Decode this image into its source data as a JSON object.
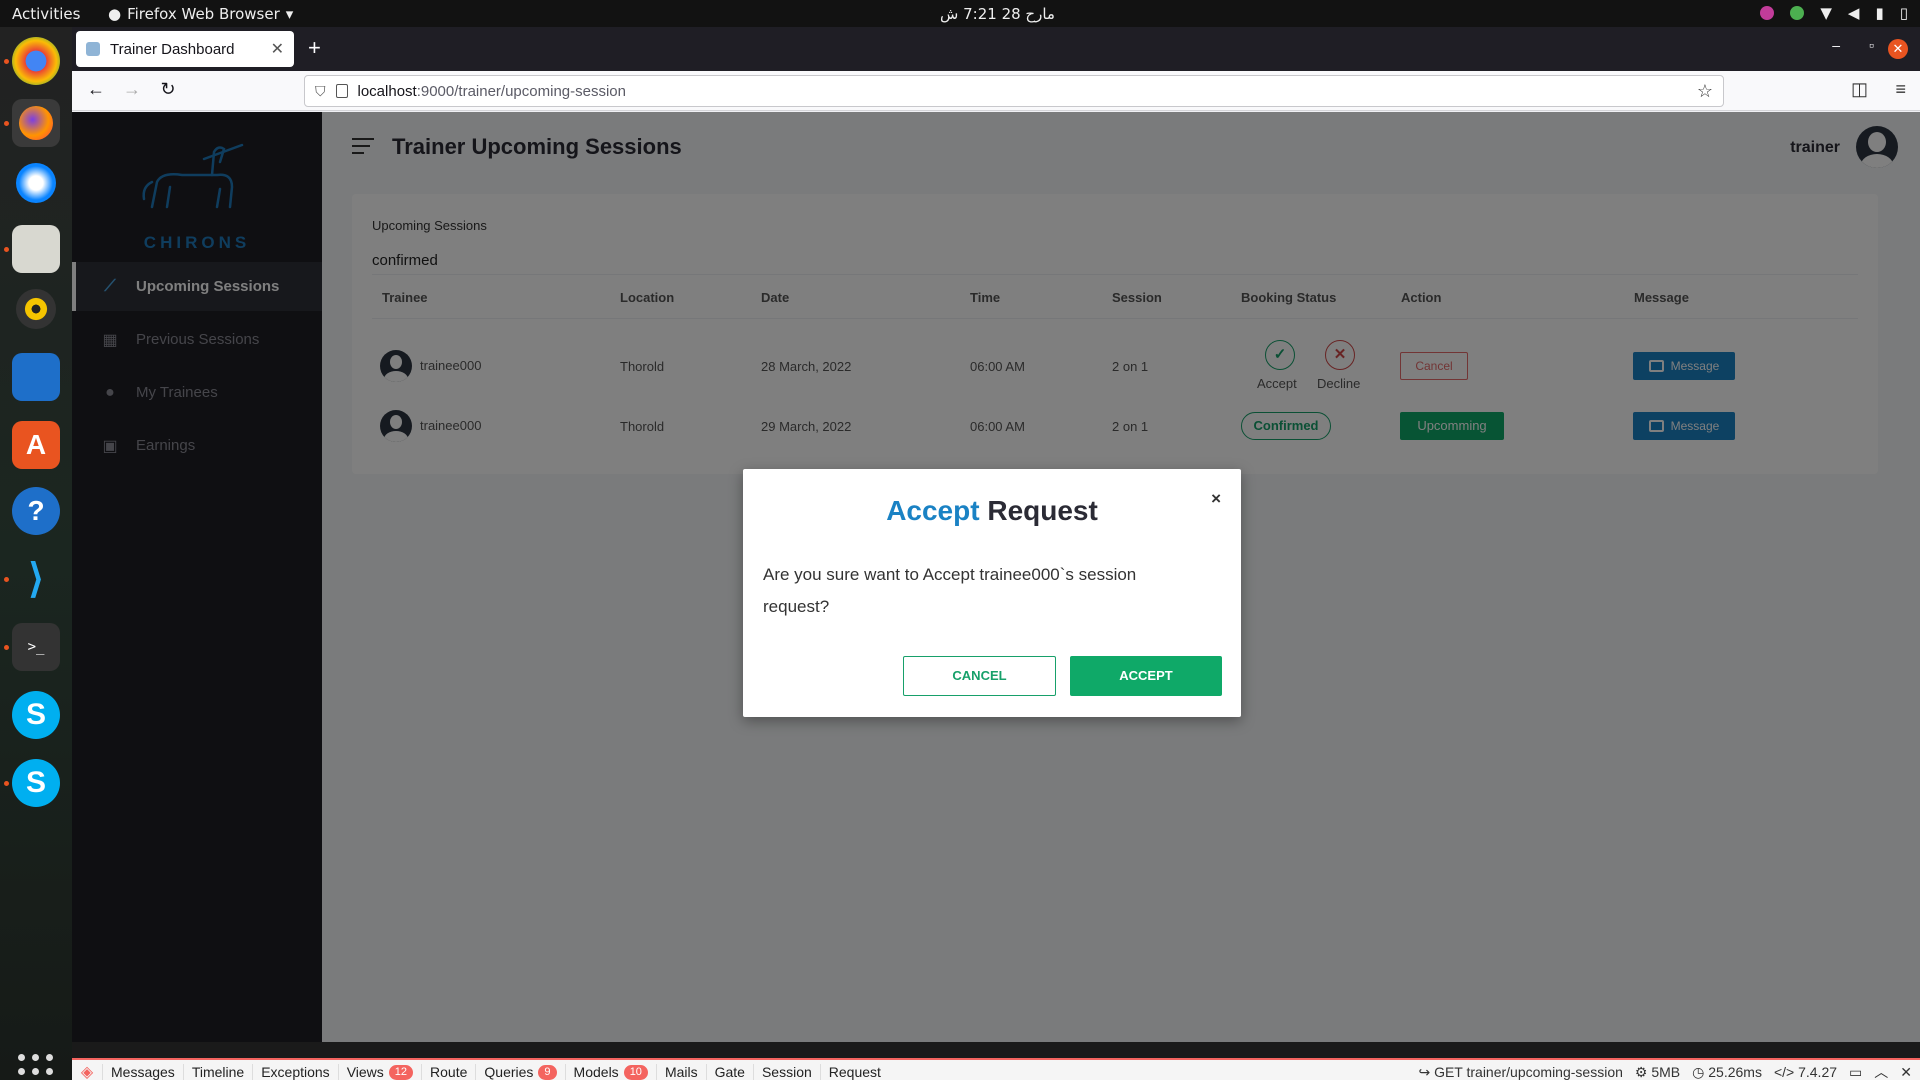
{
  "os_topbar": {
    "activities": "Activities",
    "app_menu": "Firefox Web Browser",
    "clock": "مارح 28  7:21 ش"
  },
  "browser": {
    "tab_title": "Trainer Dashboard",
    "url_host": "localhost",
    "url_path": ":9000/trainer/upcoming-session"
  },
  "sidebar": {
    "logo_text": "CHIRONS",
    "items": [
      {
        "label": "Upcoming Sessions",
        "icon": "trend-line-icon",
        "active": true
      },
      {
        "label": "Previous Sessions",
        "icon": "calendar-icon",
        "active": false
      },
      {
        "label": "My Trainees",
        "icon": "person-icon",
        "active": false
      },
      {
        "label": "Earnings",
        "icon": "money-icon",
        "active": false
      }
    ]
  },
  "header": {
    "title": "Trainer Upcoming Sessions",
    "user_name": "trainer"
  },
  "card": {
    "title": "Upcoming Sessions",
    "subtitle": "confirmed",
    "columns": [
      "Trainee",
      "Location",
      "Date",
      "Time",
      "Session",
      "Booking Status",
      "Action",
      "Message"
    ],
    "rows": [
      {
        "trainee": "trainee000",
        "location": "Thorold",
        "date": "28 March, 2022",
        "time": "06:00 AM",
        "session": "2 on 1",
        "accept_label": "Accept",
        "decline_label": "Decline",
        "action_label": "Cancel",
        "message_label": "Message"
      },
      {
        "trainee": "trainee000",
        "location": "Thorold",
        "date": "29 March, 2022",
        "time": "06:00 AM",
        "session": "2 on 1",
        "status_label": "Confirmed",
        "action_label": "Upcomming",
        "message_label": "Message"
      }
    ]
  },
  "modal": {
    "title_accent": "Accept",
    "title_rest": " Request",
    "close": "×",
    "body": "Are you sure want to Accept trainee000`s session request?",
    "cancel_label": "CANCEL",
    "accept_label": "ACCEPT"
  },
  "debugbar": {
    "tabs": [
      {
        "label": "Messages"
      },
      {
        "label": "Timeline"
      },
      {
        "label": "Exceptions"
      },
      {
        "label": "Views",
        "badge": "12"
      },
      {
        "label": "Route"
      },
      {
        "label": "Queries",
        "badge": "9"
      },
      {
        "label": "Models",
        "badge": "10"
      },
      {
        "label": "Mails"
      },
      {
        "label": "Gate"
      },
      {
        "label": "Session"
      },
      {
        "label": "Request"
      }
    ],
    "route": "GET trainer/upcoming-session",
    "memory": "5MB",
    "time": "25.26ms",
    "php_version": "7.4.27"
  },
  "colors": {
    "accent_blue": "#1a82c4",
    "success_green": "#0fa968",
    "danger_red": "#e46b6b",
    "sidebar_bg": "#1e1e24"
  }
}
